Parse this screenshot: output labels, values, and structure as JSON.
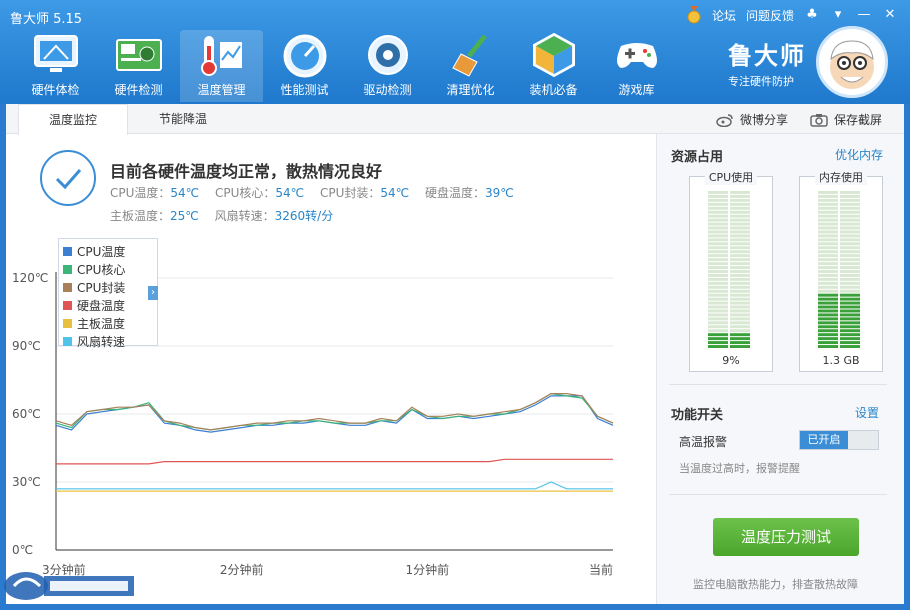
{
  "app": {
    "title": "鲁大师 5.15"
  },
  "topbar": {
    "forum": "论坛",
    "feedback": "问题反馈"
  },
  "nav": [
    {
      "label": "硬件体检",
      "icon": "monitor-icon"
    },
    {
      "label": "硬件检测",
      "icon": "board-icon"
    },
    {
      "label": "温度管理",
      "icon": "thermometer-icon"
    },
    {
      "label": "性能测试",
      "icon": "speedometer-icon"
    },
    {
      "label": "驱动检测",
      "icon": "gear-icon"
    },
    {
      "label": "清理优化",
      "icon": "broom-icon"
    },
    {
      "label": "装机必备",
      "icon": "cube-icon"
    },
    {
      "label": "游戏库",
      "icon": "gamepad-icon"
    }
  ],
  "brand": {
    "name": "鲁大师",
    "slogan": "专注硬件防护"
  },
  "tabs": {
    "monitor": "温度监控",
    "save": "节能降温"
  },
  "actions": {
    "share": "微博分享",
    "screenshot": "保存截屏"
  },
  "status": {
    "title": "目前各硬件温度均正常，散热情况良好",
    "cpu_temp_label": "CPU温度：",
    "cpu_temp": "54℃",
    "cpu_core_label": "CPU核心：",
    "cpu_core": "54℃",
    "cpu_pkg_label": "CPU封装：",
    "cpu_pkg": "54℃",
    "disk_label": "硬盘温度：",
    "disk": "39℃",
    "board_label": "主板温度：",
    "board": "25℃",
    "fan_label": "风扇转速：",
    "fan": "3260转/分"
  },
  "legend": [
    {
      "name": "CPU温度",
      "color": "#3a7fd0"
    },
    {
      "name": "CPU核心",
      "color": "#3bb57a"
    },
    {
      "name": "CPU封装",
      "color": "#a8805a"
    },
    {
      "name": "硬盘温度",
      "color": "#e05555"
    },
    {
      "name": "主板温度",
      "color": "#e8c040"
    },
    {
      "name": "风扇转速",
      "color": "#4fc3e8"
    }
  ],
  "chart_data": {
    "type": "line",
    "y_ticks": [
      "120℃",
      "90℃",
      "60℃",
      "30℃",
      "0℃"
    ],
    "x_ticks": [
      "3分钟前",
      "2分钟前",
      "1分钟前",
      "当前"
    ],
    "ylim": [
      0,
      120
    ],
    "x": [
      0,
      5,
      10,
      15,
      20,
      25,
      30,
      35,
      40,
      45,
      50,
      55,
      60,
      65,
      70,
      75,
      80,
      85,
      90,
      95,
      100,
      105,
      110,
      115,
      120,
      125,
      130,
      135,
      140,
      145,
      150,
      155,
      160,
      165,
      170,
      175,
      180
    ],
    "series": [
      {
        "name": "CPU温度",
        "color": "#3a7fd0",
        "values": [
          55,
          53,
          60,
          61,
          62,
          63,
          64,
          56,
          55,
          53,
          52,
          53,
          54,
          55,
          55,
          56,
          56,
          57,
          56,
          55,
          55,
          57,
          56,
          62,
          58,
          58,
          59,
          58,
          59,
          60,
          61,
          64,
          68,
          68,
          68,
          58,
          55
        ]
      },
      {
        "name": "CPU核心",
        "color": "#3bb57a",
        "values": [
          56,
          54,
          61,
          62,
          62,
          63,
          65,
          57,
          55,
          54,
          53,
          54,
          55,
          55,
          56,
          56,
          57,
          57,
          56,
          56,
          56,
          57,
          57,
          62,
          59,
          58,
          59,
          59,
          60,
          60,
          62,
          65,
          69,
          68,
          67,
          59,
          56
        ]
      },
      {
        "name": "CPU封装",
        "color": "#a8805a",
        "values": [
          57,
          55,
          61,
          62,
          63,
          63,
          64,
          57,
          56,
          54,
          53,
          54,
          55,
          56,
          56,
          57,
          57,
          58,
          57,
          56,
          56,
          58,
          57,
          63,
          59,
          59,
          60,
          59,
          60,
          61,
          62,
          65,
          69,
          69,
          68,
          59,
          56
        ]
      },
      {
        "name": "硬盘温度",
        "color": "#e05555",
        "values": [
          38,
          38,
          38,
          38,
          38,
          38,
          38,
          39,
          39,
          39,
          39,
          39,
          39,
          39,
          39,
          39,
          39,
          39,
          39,
          39,
          39,
          39,
          39,
          39,
          39,
          39,
          39,
          39,
          39,
          40,
          40,
          40,
          40,
          40,
          40,
          40,
          40
        ]
      },
      {
        "name": "主板温度",
        "color": "#e8c040",
        "values": [
          26,
          26,
          26,
          26,
          26,
          26,
          26,
          26,
          26,
          26,
          26,
          26,
          26,
          26,
          26,
          26,
          26,
          26,
          26,
          26,
          26,
          26,
          26,
          26,
          26,
          26,
          26,
          26,
          26,
          26,
          26,
          26,
          26,
          26,
          26,
          26,
          26
        ]
      },
      {
        "name": "风扇转速",
        "color": "#4fc3e8",
        "values": [
          27,
          27,
          27,
          27,
          27,
          27,
          27,
          27,
          27,
          27,
          27,
          27,
          27,
          27,
          27,
          27,
          27,
          27,
          27,
          27,
          27,
          27,
          27,
          27,
          27,
          27,
          27,
          27,
          27,
          27,
          27,
          27,
          30,
          27,
          27,
          27,
          27
        ]
      }
    ]
  },
  "resources": {
    "title": "资源占用",
    "optimize": "优化内存",
    "cpu_label": "CPU使用",
    "cpu_value": "9%",
    "cpu_fraction": 0.09,
    "mem_label": "内存使用",
    "mem_value": "1.3 GB",
    "mem_fraction": 0.34
  },
  "features": {
    "title": "功能开关",
    "settings": "设置",
    "alarm_label": "高温报警",
    "alarm_state": "已开启",
    "alarm_hint": "当温度过高时，报警提醒"
  },
  "stress": {
    "button": "温度压力测试",
    "hint": "监控电脑散热能力，排查散热故障"
  }
}
